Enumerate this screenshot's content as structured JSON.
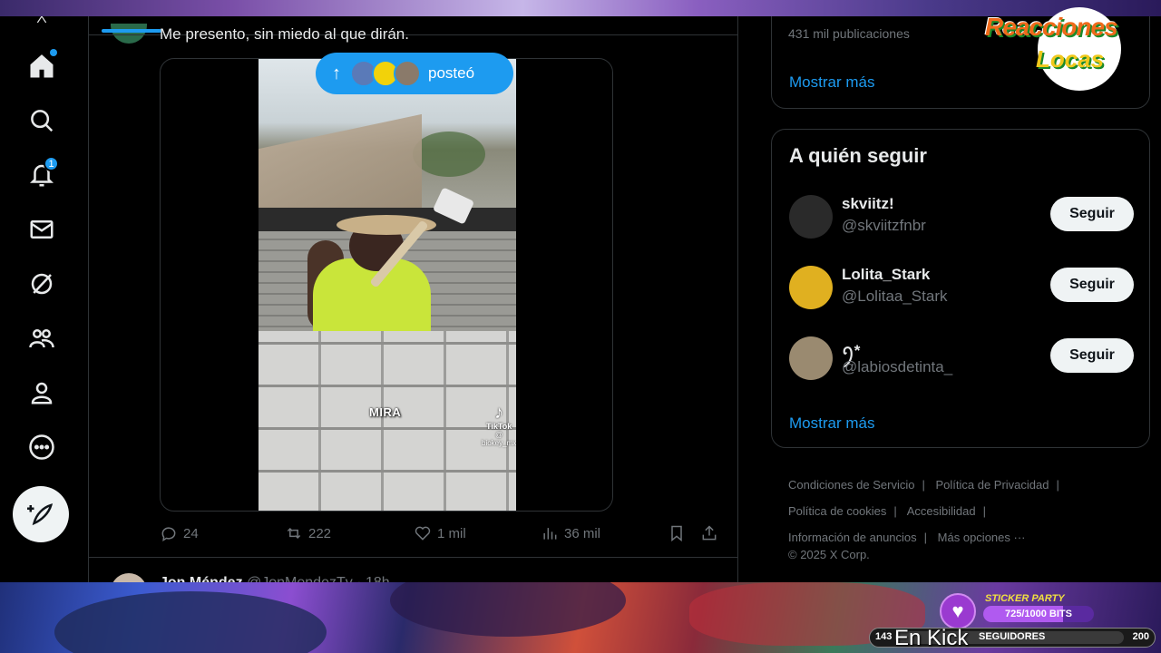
{
  "tweet": {
    "text": "Me presento, sin miedo al que dirán.",
    "video_caption": "MIRA",
    "tiktok_label": "TikTok",
    "tiktok_handle": "@ biokey_mx",
    "posted_pill_label": "posteó",
    "actions": {
      "replies": "24",
      "reposts": "222",
      "likes": "1 mil",
      "views": "36 mil"
    }
  },
  "next_tweet": {
    "name": "Jon Méndez",
    "handle": "@JonMendezTv · 18h"
  },
  "nav": {
    "notifications_badge": "1"
  },
  "sidebar": {
    "top_card_faded": "431 mil publicaciones",
    "top_card_show_more": "Mostrar más",
    "who_to_follow": {
      "title": "A quién seguir",
      "users": [
        {
          "name": "skviitz!",
          "handle": "@skviitzfnbr",
          "button": "Seguir",
          "avatar_color": "#2a2a2a"
        },
        {
          "name": "Lolita_Stark",
          "handle": "@Lolitaa_Stark",
          "button": "Seguir",
          "avatar_color": "#e0b020"
        },
        {
          "name": "ꪆ*",
          "handle": "@labiosdetinta_",
          "button": "Seguir",
          "avatar_color": "#9a8a70"
        }
      ],
      "show_more": "Mostrar más"
    },
    "footer": {
      "links": [
        "Condiciones de Servicio",
        "Política de Privacidad",
        "Política de cookies",
        "Accesibilidad",
        "Información de anuncios",
        "Más opciones ···"
      ],
      "copyright": "© 2025 X Corp."
    }
  },
  "overlay": {
    "logo_line1": "Reacciones",
    "logo_line2": "Locas",
    "sticker_title": "STICKER PARTY",
    "sticker_progress": "725/1000 BITS",
    "sticker_fraction": 0.725,
    "followers_count": "143",
    "followers_label": "SEGUIDORES",
    "followers_goal": "200",
    "en_kick": "En Kick"
  },
  "colors": {
    "accent": "#1d9bf0",
    "background": "#000000",
    "border": "#2f3336",
    "muted_text": "#71767b"
  }
}
